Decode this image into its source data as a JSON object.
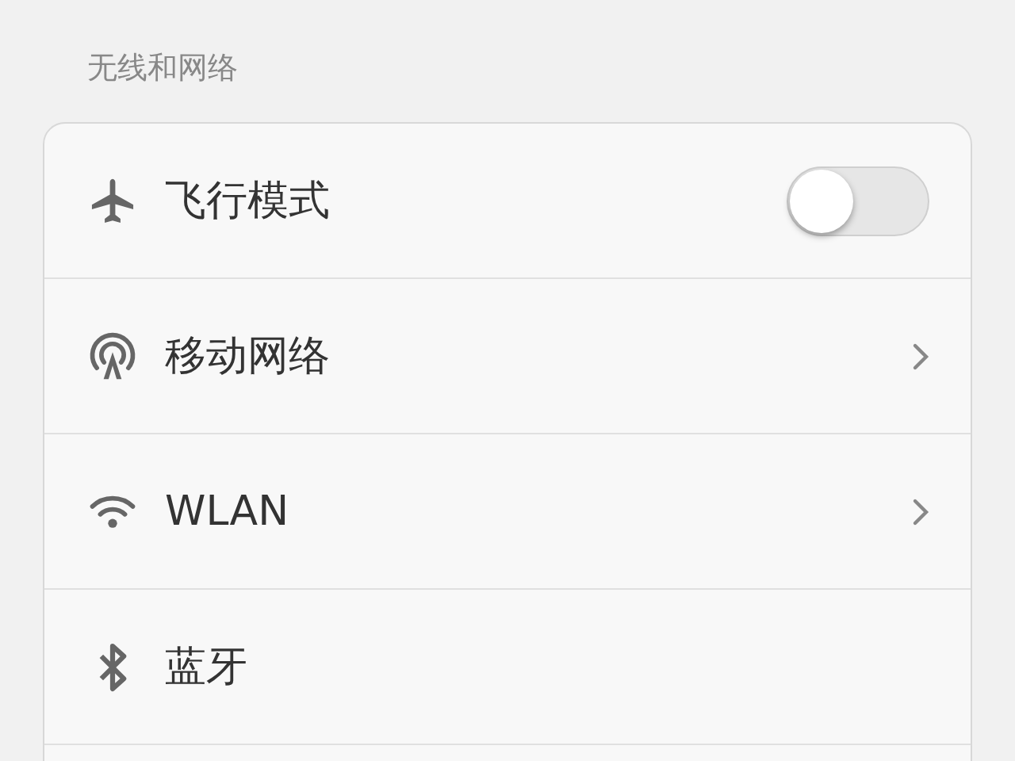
{
  "section_title": "无线和网络",
  "rows": [
    {
      "kind": "toggle",
      "label": "飞行模式",
      "on": false
    },
    {
      "kind": "chevron",
      "label": "移动网络"
    },
    {
      "kind": "chevron",
      "label": "WLAN"
    },
    {
      "kind": "plain",
      "label": "蓝牙"
    }
  ]
}
